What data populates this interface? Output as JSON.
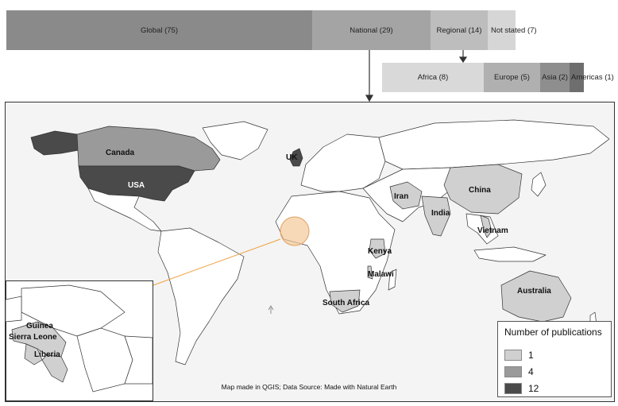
{
  "top_bars": [
    {
      "label": "Global (75)",
      "color": "#8a8a8a"
    },
    {
      "label": "National (29)",
      "color": "#a4a4a4"
    },
    {
      "label": "Regional (14)",
      "color": "#bdbdbd"
    },
    {
      "label": "Not stated (7)",
      "color": "#d6d6d6"
    }
  ],
  "regional_bars": [
    {
      "label": "Africa (8)",
      "color": "#d9d9d9"
    },
    {
      "label": "Europe (5)",
      "color": "#b0b0b0"
    },
    {
      "label": "Asia (2)",
      "color": "#8e8e8e"
    },
    {
      "label": "Americas (1)",
      "color": "#6e6e6e"
    }
  ],
  "countries": {
    "canada": "Canada",
    "usa": "USA",
    "uk": "UK",
    "iran": "Iran",
    "china": "China",
    "india": "India",
    "vietnam": "Vietnam",
    "kenya": "Kenya",
    "malawi": "Malawi",
    "south_africa": "South Africa",
    "australia": "Australia"
  },
  "inset_countries": {
    "guinea": "Guinea",
    "sierra_leone": "Sierra Leone",
    "liberia": "Liberia"
  },
  "legend": {
    "title": "Number of publications",
    "items": [
      {
        "label": "1",
        "color": "#d0d0d0"
      },
      {
        "label": "4",
        "color": "#9a9a9a"
      },
      {
        "label": "12",
        "color": "#4a4a4a"
      }
    ]
  },
  "caption": "Map made in QGIS; Data Source: Made with Natural Earth",
  "colors": {
    "highlight": "#f3c99a",
    "connector": "#f0a040"
  }
}
